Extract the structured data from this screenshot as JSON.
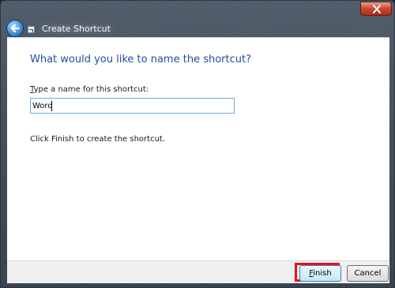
{
  "window": {
    "title": "Create Shortcut"
  },
  "main": {
    "heading": "What would you like to name the shortcut?",
    "field_label_accel": "T",
    "field_label_rest": "ype a name for this shortcut:",
    "name_value": "Word",
    "info_text": "Click Finish to create the shortcut."
  },
  "footer": {
    "finish_accel": "F",
    "finish_rest": "inish",
    "cancel_label": "Cancel"
  },
  "colors": {
    "heading": "#1e4f9c",
    "highlight": "#e8141c"
  },
  "icons": {
    "back": "back-arrow-icon",
    "close": "close-icon",
    "shortcut": "shortcut-icon"
  }
}
